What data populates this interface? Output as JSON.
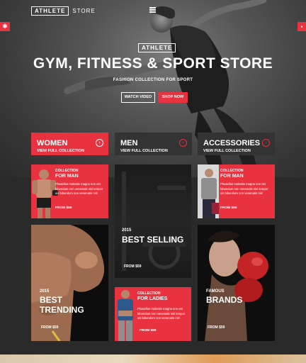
{
  "header": {
    "logo_box": "ATHLETE",
    "logo_text": "STORE"
  },
  "hero": {
    "badge": "ATHLETE",
    "title": "GYM, FITNESS & SPORT STORE",
    "subtitle": "FASHION COLLECTION FOR SPORT",
    "watch_label": "WATCH VIDEO",
    "shop_label": "SHOP NOW"
  },
  "categories": [
    {
      "title": "WOMEN",
      "sub": "VIEW FULL COLLECTION",
      "arrow": "›"
    },
    {
      "title": "MEN",
      "sub": "VIEW FULL COLLECTION",
      "arrow": "›"
    },
    {
      "title": "ACCESSORIES",
      "sub": "VIEW FULL COLLECTION",
      "arrow": "›"
    }
  ],
  "promo_man": {
    "collection": "COLLECTION",
    "for": "FOR MAN",
    "desc": "Phasellus molestie magna non est bibendum non venenatis nisl tempor uis bibendum non venenatis nisl",
    "price": "FROM $59"
  },
  "promo_jacket": {
    "collection": "COLLECTION",
    "for": "FOR MAN",
    "desc": "Phasellus molestie magna non est bibendum non venenatis nisl tempor uis bibendum non venenatis nisl",
    "price": "FROM $59"
  },
  "promo_ladies": {
    "collection": "COLLECTION",
    "for": "FOR LADIES",
    "desc": "Phasellus molestie magna non est bibendum non venenatis nisl tempor uis bibendum non venenatis nisl",
    "price": "FROM $59"
  },
  "best_selling": {
    "year": "2015",
    "title": "BEST SELLING",
    "price": "FROM $59"
  },
  "best_trending": {
    "year": "2015",
    "title": "BEST TRENDING",
    "price": "FROM $59"
  },
  "brands": {
    "sub": "FAMOUS",
    "title": "BRANDS",
    "price": "FROM $59"
  },
  "colors": {
    "accent": "#e8323f",
    "dark": "#2a2a2a",
    "tile": "#333333"
  },
  "icons": {
    "menu": "hamburger-icon",
    "left_tab": "gear-icon",
    "right_tab": "cart-icon",
    "arrow": "arrow-right-circle-icon"
  }
}
